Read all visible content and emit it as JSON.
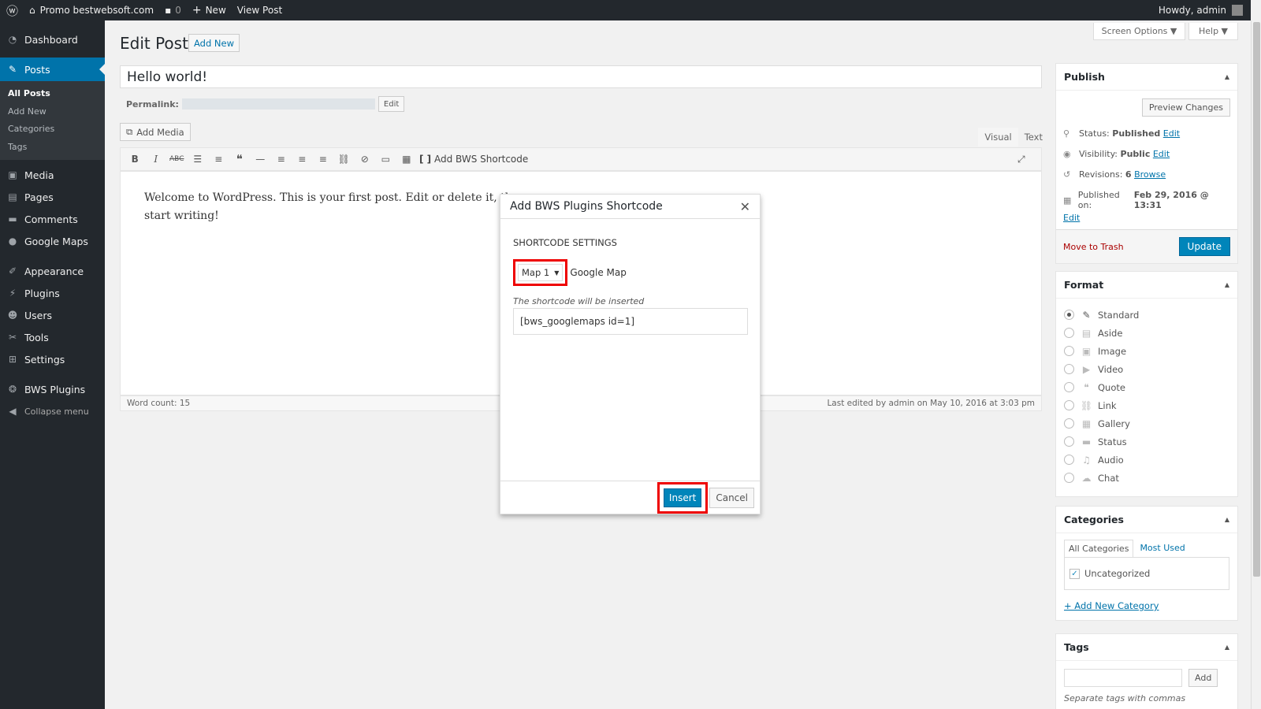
{
  "admin_bar": {
    "site_name": "Promo bestwebsoft.com",
    "comments_count": "0",
    "new_label": "New",
    "view_post": "View Post",
    "howdy": "Howdy, admin"
  },
  "sidebar": {
    "items": [
      {
        "label": "Dashboard",
        "icon": "dashboard-icon"
      },
      {
        "label": "Posts",
        "icon": "pin-icon",
        "active": true
      },
      {
        "label": "Media",
        "icon": "media-icon"
      },
      {
        "label": "Pages",
        "icon": "pages-icon"
      },
      {
        "label": "Comments",
        "icon": "comments-icon"
      },
      {
        "label": "Google Maps",
        "icon": "map-pin-icon"
      },
      {
        "label": "Appearance",
        "icon": "brush-icon"
      },
      {
        "label": "Plugins",
        "icon": "plugin-icon"
      },
      {
        "label": "Users",
        "icon": "users-icon"
      },
      {
        "label": "Tools",
        "icon": "wrench-icon"
      },
      {
        "label": "Settings",
        "icon": "settings-icon"
      },
      {
        "label": "BWS Plugins",
        "icon": "bws-icon"
      },
      {
        "label": "Collapse menu",
        "icon": "collapse-icon"
      }
    ],
    "posts_sub": [
      "All Posts",
      "Add New",
      "Categories",
      "Tags"
    ]
  },
  "header": {
    "screen_options": "Screen Options ▼",
    "help": "Help ▼",
    "title": "Edit Post",
    "add_new": "Add New"
  },
  "editor": {
    "post_title": "Hello world!",
    "permalink_label": "Permalink:",
    "permalink_edit": "Edit",
    "add_media": "Add Media",
    "tab_visual": "Visual",
    "tab_text": "Text",
    "bws_button": "Add BWS Shortcode",
    "content": "Welcome to WordPress. This is your first post. Edit or delete it, then start writing!",
    "word_count": "Word count: 15",
    "last_edited": "Last edited by admin on May 10, 2016 at 3:03 pm"
  },
  "publish": {
    "title": "Publish",
    "preview": "Preview Changes",
    "status_label": "Status:",
    "status_value": "Published",
    "visibility_label": "Visibility:",
    "visibility_value": "Public",
    "revisions_label": "Revisions:",
    "revisions_value": "6",
    "browse": "Browse",
    "published_label": "Published on:",
    "published_value": "Feb 29, 2016 @ 13:31",
    "edit": "Edit",
    "trash": "Move to Trash",
    "update": "Update"
  },
  "format": {
    "title": "Format",
    "options": [
      "Standard",
      "Aside",
      "Image",
      "Video",
      "Quote",
      "Link",
      "Gallery",
      "Status",
      "Audio",
      "Chat"
    ],
    "selected": "Standard"
  },
  "categories": {
    "title": "Categories",
    "tab_all": "All Categories",
    "tab_most": "Most Used",
    "item": "Uncategorized",
    "add_new": "+ Add New Category"
  },
  "tags": {
    "title": "Tags",
    "add": "Add",
    "hint": "Separate tags with commas"
  },
  "modal": {
    "title": "Add BWS Plugins Shortcode",
    "section": "SHORTCODE SETTINGS",
    "select_value": "Map 1",
    "select_suffix": "Google Map",
    "note": "The shortcode will be inserted",
    "shortcode": "[bws_googlemaps id=1]",
    "insert": "Insert",
    "cancel": "Cancel"
  },
  "colors": {
    "accent": "#0073aa",
    "highlight": "#e00000",
    "admin_bar": "#23282d"
  }
}
